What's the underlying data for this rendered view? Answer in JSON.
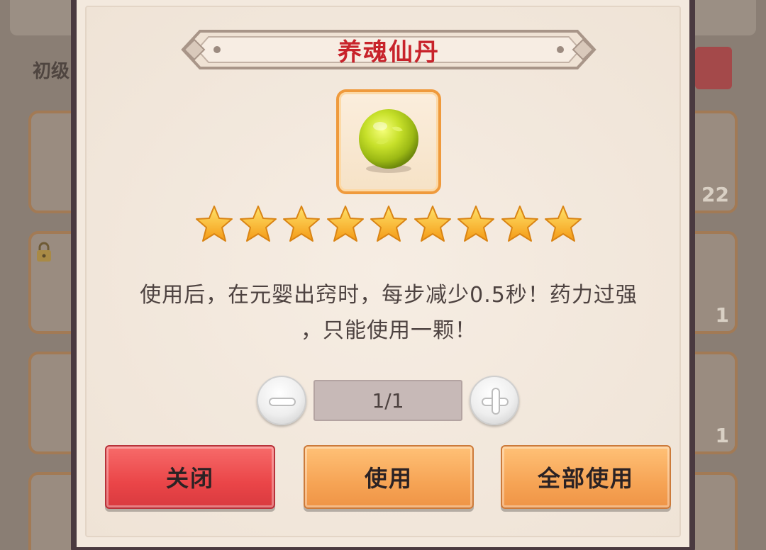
{
  "background": {
    "left_label": "初级",
    "right_counts": [
      "22",
      "1",
      "1"
    ]
  },
  "dialog": {
    "title": "养魂仙丹",
    "item_icon": "green-yellow-pill-orb",
    "star_count": 9,
    "description_line1": "使用后，在元婴出窍时，每步减少0.5秒！药力过强",
    "description_line2": "，只能使用一颗！",
    "quantity": "1/1",
    "buttons": {
      "close": "关闭",
      "use": "使用",
      "use_all": "全部使用"
    }
  },
  "colors": {
    "title": "#c8232b",
    "close_button": "#ea4548",
    "use_button": "#f6a455",
    "frame_border": "#ef9a3c"
  }
}
